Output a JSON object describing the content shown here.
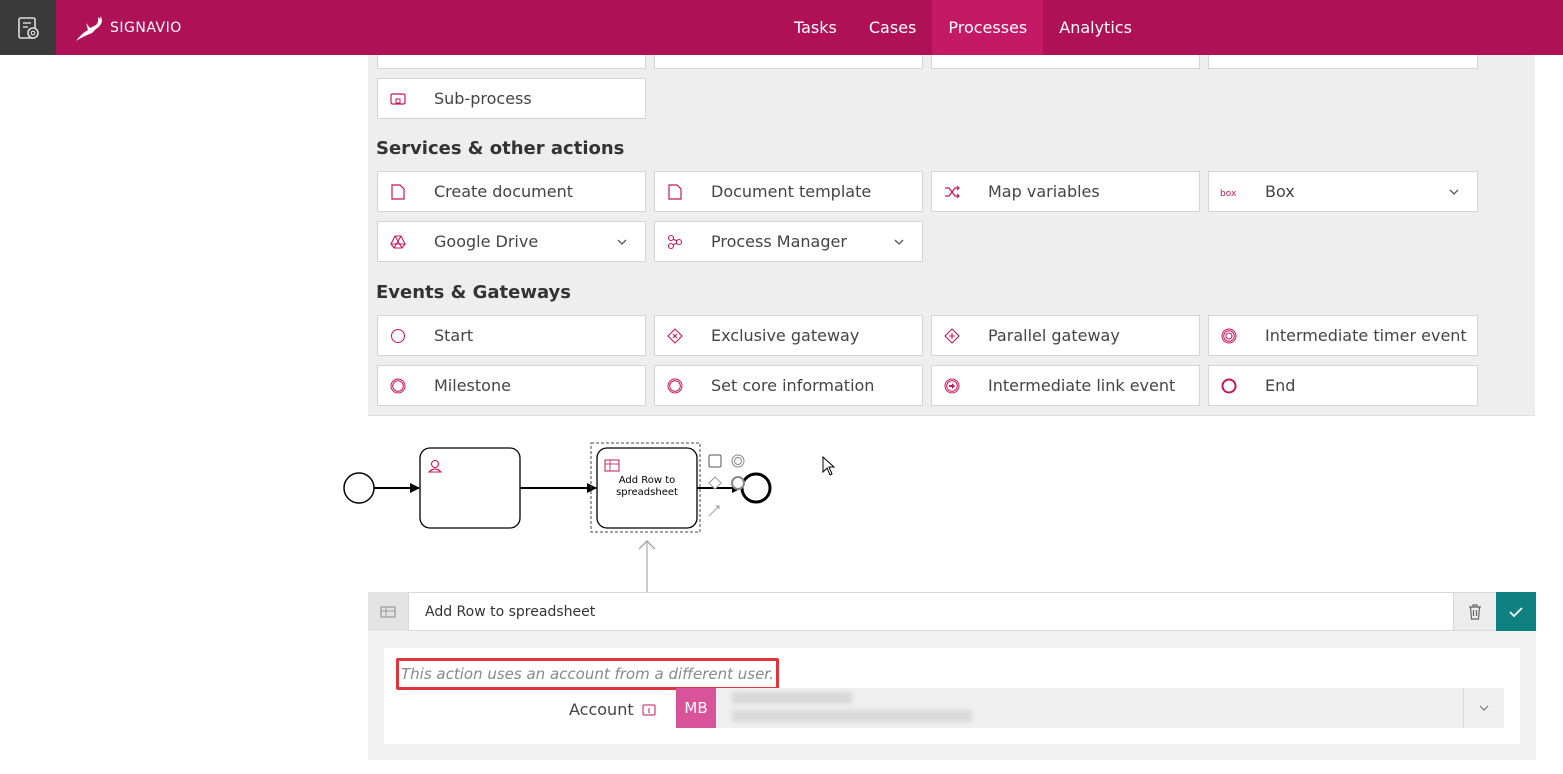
{
  "header": {
    "logo_text": "SIGNAVIO",
    "nav": [
      "Tasks",
      "Cases",
      "Processes",
      "Analytics"
    ],
    "active_nav": "Processes",
    "brand_color": "#af1157"
  },
  "palette": {
    "subprocess_label": "Sub-process",
    "services_title": "Services & other actions",
    "services": [
      {
        "label": "Create document",
        "icon": "document-icon"
      },
      {
        "label": "Document template",
        "icon": "document-icon"
      },
      {
        "label": "Map variables",
        "icon": "shuffle-icon"
      },
      {
        "label": "Box",
        "icon": "box-logo-icon"
      },
      {
        "label": "Google Drive",
        "icon": "google-drive-icon"
      },
      {
        "label": "Process Manager",
        "icon": "process-manager-icon"
      }
    ],
    "events_title": "Events & Gateways",
    "events": [
      {
        "label": "Start",
        "icon": "start-event-icon"
      },
      {
        "label": "Exclusive gateway",
        "icon": "exclusive-gateway-icon"
      },
      {
        "label": "Parallel gateway",
        "icon": "parallel-gateway-icon"
      },
      {
        "label": "Intermediate timer event",
        "icon": "timer-event-icon"
      },
      {
        "label": "Milestone",
        "icon": "milestone-icon"
      },
      {
        "label": "Set core information",
        "icon": "core-info-icon"
      },
      {
        "label": "Intermediate link event",
        "icon": "link-event-icon"
      },
      {
        "label": "End",
        "icon": "end-event-icon"
      }
    ]
  },
  "diagram": {
    "selected_task_label": "Add Row to spreadsheet"
  },
  "properties": {
    "name_value": "Add Row to spreadsheet",
    "warning": "This action uses an account from a different user.",
    "account_label": "Account",
    "account_avatar": "MB"
  }
}
